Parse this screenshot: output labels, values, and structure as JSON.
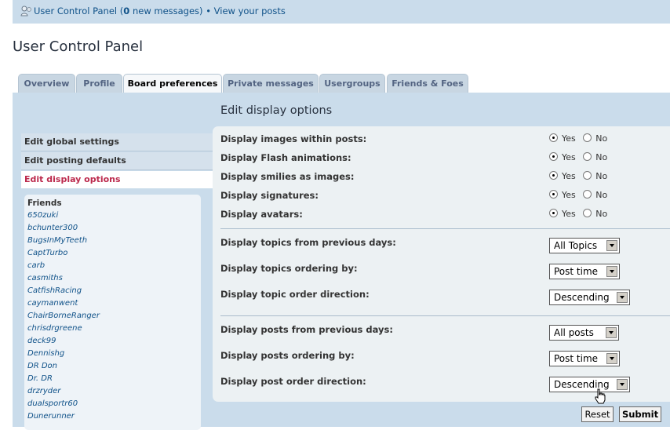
{
  "header": {
    "ucp_link": "User Control Panel",
    "messages_open": "(",
    "messages_count": "0",
    "messages_text": " new messages) • ",
    "view_posts": "View your posts"
  },
  "page": {
    "title": "User Control Panel"
  },
  "tabs": [
    {
      "label": "Overview",
      "active": false
    },
    {
      "label": "Profile",
      "active": false
    },
    {
      "label": "Board preferences",
      "active": true
    },
    {
      "label": "Private messages",
      "active": false
    },
    {
      "label": "Usergroups",
      "active": false
    },
    {
      "label": "Friends & Foes",
      "active": false
    }
  ],
  "section": {
    "title": "Edit display options"
  },
  "nav": [
    {
      "label": "Edit global settings"
    },
    {
      "label": "Edit posting defaults"
    },
    {
      "label": "Edit display options"
    }
  ],
  "friends": {
    "title": "Friends",
    "list": [
      "650zuki",
      "bchunter300",
      "BugsInMyTeeth",
      "CaptTurbo",
      "carb",
      "casmiths",
      "CatfishRacing",
      "caymanwent",
      "ChairBorneRanger",
      "chrisdrgreene",
      "deck99",
      "Dennishg",
      "DR Don",
      "Dr. DR",
      "drzryder",
      "dualsportr60",
      "Dunerunner"
    ]
  },
  "yes_label": "Yes",
  "no_label": "No",
  "radio_options": [
    {
      "label": "Display images within posts:",
      "value": "Yes"
    },
    {
      "label": "Display Flash animations:",
      "value": "Yes"
    },
    {
      "label": "Display smilies as images:",
      "value": "Yes"
    },
    {
      "label": "Display signatures:",
      "value": "Yes"
    },
    {
      "label": "Display avatars:",
      "value": "Yes"
    }
  ],
  "topic_options": [
    {
      "label": "Display topics from previous days:",
      "value": "All Topics"
    },
    {
      "label": "Display topics ordering by:",
      "value": "Post time"
    },
    {
      "label": "Display topic order direction:",
      "value": "Descending"
    }
  ],
  "post_options": [
    {
      "label": "Display posts from previous days:",
      "value": "All posts"
    },
    {
      "label": "Display posts ordering by:",
      "value": "Post time"
    },
    {
      "label": "Display post order direction:",
      "value": "Descending"
    }
  ],
  "buttons": {
    "reset": "Reset",
    "submit": "Submit"
  },
  "colors": {
    "accent": "#105289",
    "active_nav": "#bc2a4d",
    "panel": "#cadceb"
  }
}
